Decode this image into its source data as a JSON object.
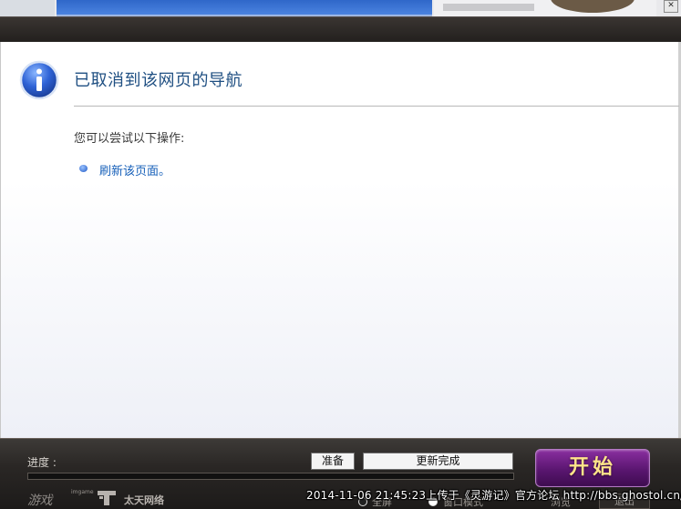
{
  "window": {
    "close_glyph": "ⓧ"
  },
  "error_page": {
    "title": "已取消到该网页的导航",
    "subtitle": "您可以尝试以下操作:",
    "actions": [
      {
        "label": "刷新该页面。"
      }
    ],
    "icon": "info-icon",
    "accent_color": "#1f4f82",
    "link_color": "#1760b9"
  },
  "launcher": {
    "progress_label": "进度 :",
    "status_ready": "准备",
    "status_update": "更新完成",
    "progress_fraction": 0,
    "start_label": "开始",
    "options": {
      "fullscreen": "全屏",
      "windowed": "窗口模式",
      "browse": "浏览",
      "exit": "退出"
    },
    "logo_text": "游戏",
    "logo_small": "imgame",
    "company": "太天网络"
  },
  "watermark": "2014-11-06 21:45:23上传于《灵游记》官方论坛 http://bbs.ghostol.cn/"
}
